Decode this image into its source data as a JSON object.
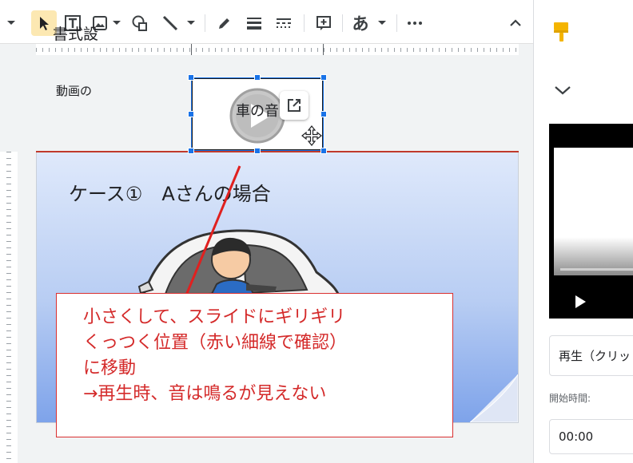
{
  "slide": {
    "title": "ケース①　Aさんの場合"
  },
  "video": {
    "label": "車の音"
  },
  "callout": {
    "lines": [
      "小さくして、スライドにギリギリ",
      "くっつく位置（赤い細線で確認）",
      "に移動",
      "→再生時、音は鳴るが見えない"
    ]
  },
  "toolbar": {
    "text_tool_label": "あ"
  },
  "panel": {
    "title": "書式設",
    "section": "動画の",
    "playback_select": "再生（クリッ",
    "start_label": "開始時間:",
    "start_value": "00:00"
  },
  "colors": {
    "accent": "#1a73e8",
    "annotation_red": "#d42a2a",
    "active_tool": "#fce8b2",
    "panel_icon": "#f4b400"
  }
}
